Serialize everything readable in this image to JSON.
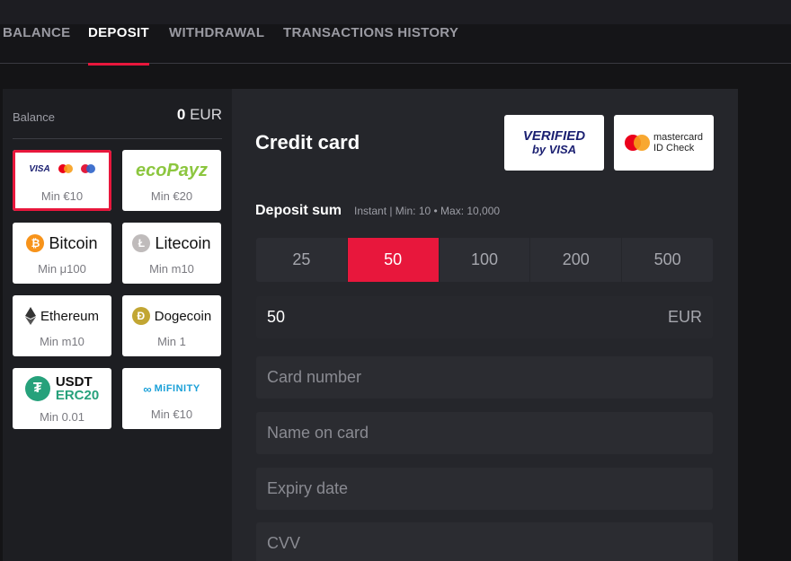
{
  "tabs": [
    {
      "label": "BALANCE",
      "active": false
    },
    {
      "label": "DEPOSIT",
      "active": true
    },
    {
      "label": "WITHDRAWAL",
      "active": false
    },
    {
      "label": "TRANSACTIONS HISTORY",
      "active": false
    }
  ],
  "sidebar": {
    "balance_label": "Balance",
    "balance_amount": "0",
    "balance_currency": "EUR",
    "methods": [
      {
        "logo_text": "VISA",
        "min": "Min €10",
        "selected": true
      },
      {
        "logo_text": "ecoPayz",
        "min": "Min €20"
      },
      {
        "logo_text": "Bitcoin",
        "min": "Min μ100"
      },
      {
        "logo_text": "Litecoin",
        "min": "Min m10"
      },
      {
        "logo_text": "Ethereum",
        "min": "Min m10"
      },
      {
        "logo_text": "Dogecoin",
        "min": "Min 1"
      },
      {
        "logo_text": "USDT",
        "logo_sub": "ERC20",
        "min": "Min 0.01"
      },
      {
        "logo_text": "MiFINITY",
        "min": "Min €10"
      }
    ]
  },
  "main": {
    "title": "Credit card",
    "badges": {
      "visa_verified": "VERIFIED",
      "visa_by": "by VISA",
      "mastercard_name": "mastercard",
      "mastercard_sub": "ID Check"
    },
    "deposit_label": "Deposit sum",
    "deposit_info": "Instant | Min: 10 • Max: 10,000",
    "amounts": [
      "25",
      "50",
      "100",
      "200",
      "500"
    ],
    "selected_amount": "50",
    "sum_value": "50",
    "sum_currency": "EUR",
    "fields": {
      "card_number_placeholder": "Card number",
      "name_placeholder": "Name on card",
      "expiry_placeholder": "Expiry date",
      "cvv_placeholder": "CVV"
    }
  },
  "colors": {
    "accent": "#e8173c",
    "panel": "#25262b",
    "sidebar": "#1d1e22"
  }
}
